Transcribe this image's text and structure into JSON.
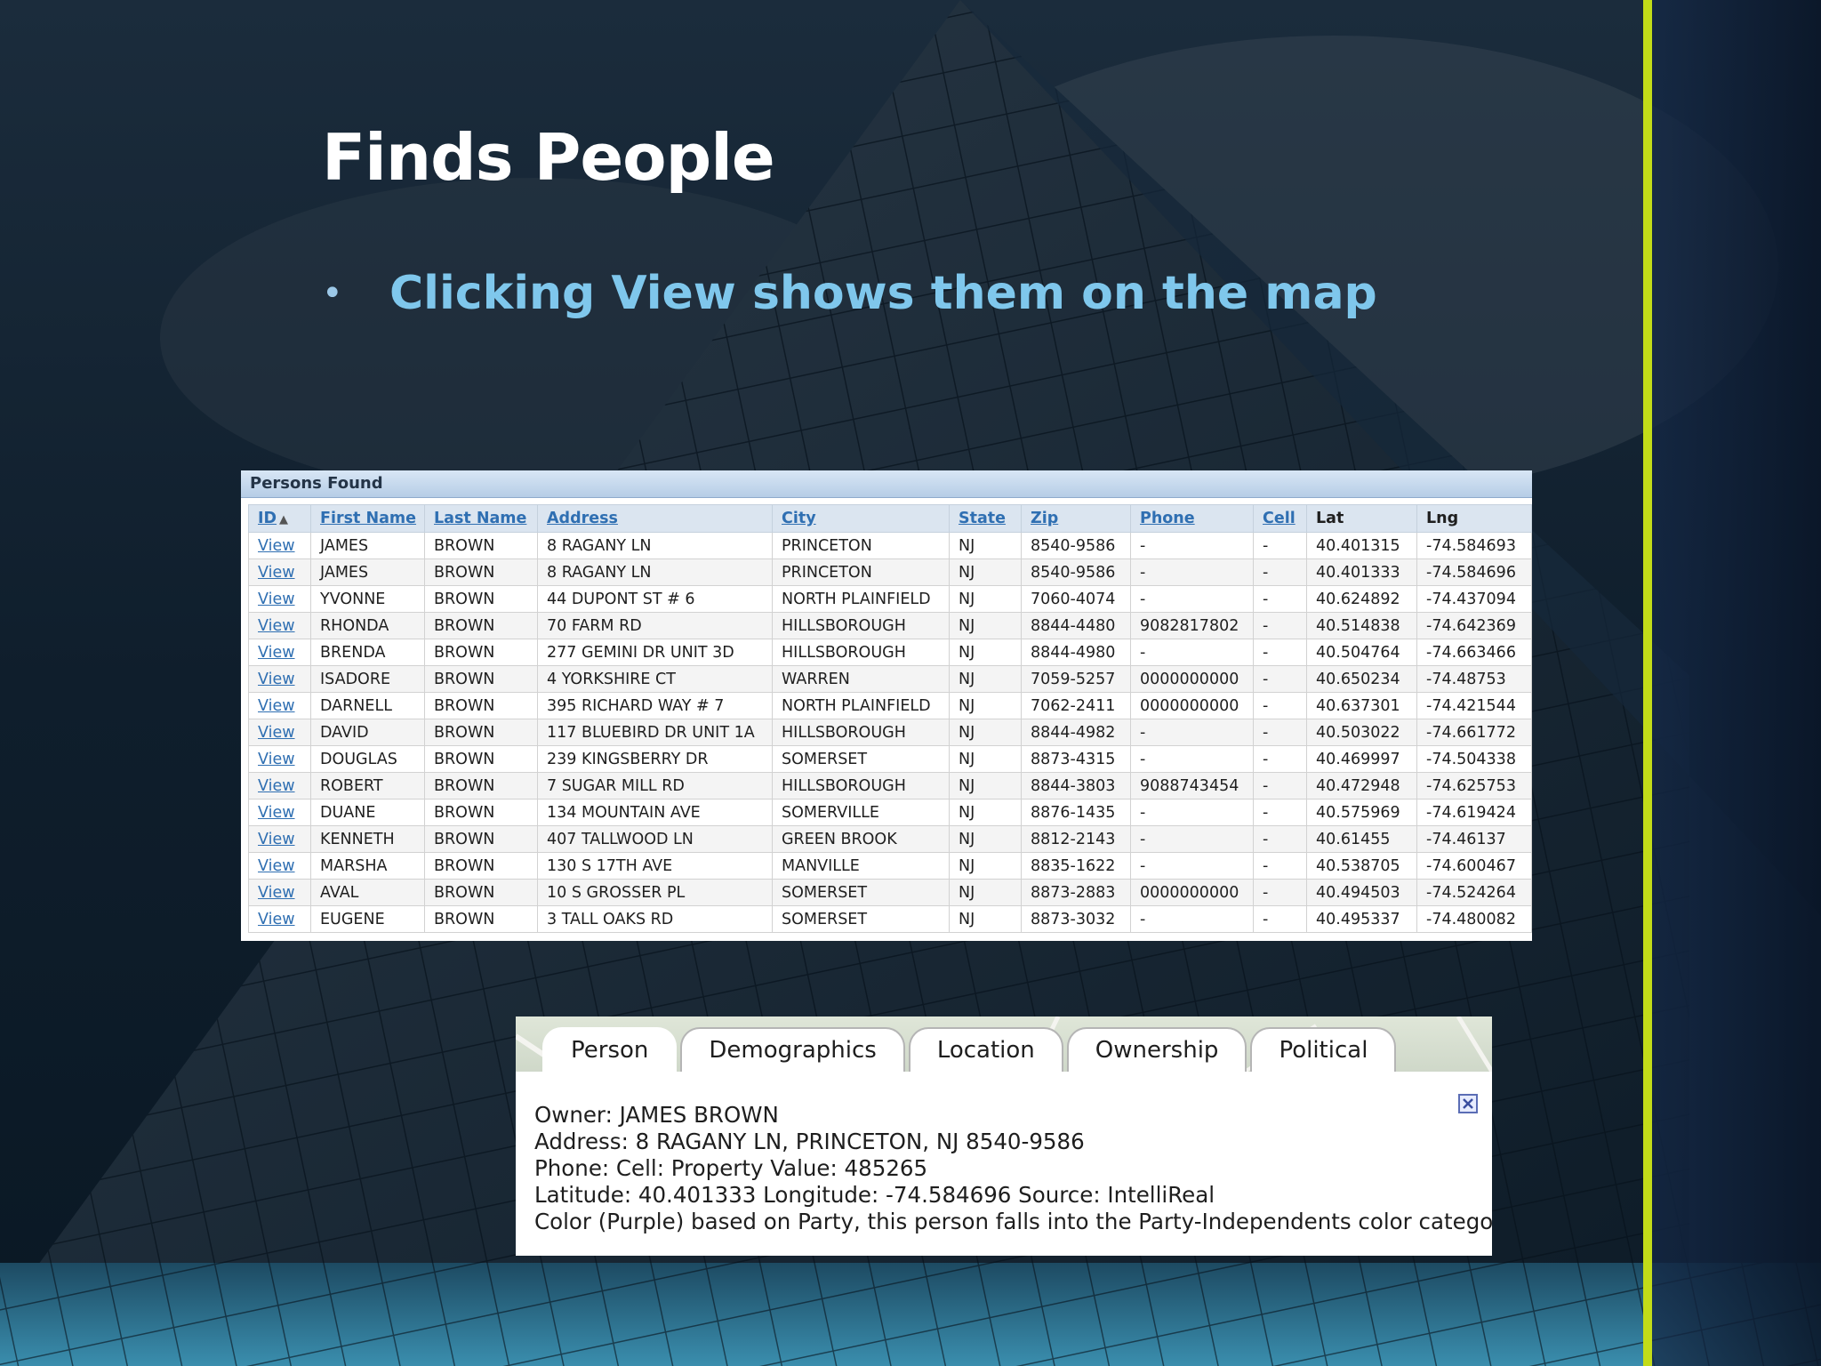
{
  "slide": {
    "title": "Finds People",
    "bullet": "Clicking View shows them on the map"
  },
  "persons_panel": {
    "header": "Persons Found",
    "columns": [
      "ID",
      "First Name",
      "Last Name",
      "Address",
      "City",
      "State",
      "Zip",
      "Phone",
      "Cell",
      "Lat",
      "Lng"
    ],
    "sort_indicator": "▲",
    "rows": [
      [
        "View",
        "JAMES",
        "BROWN",
        "8 RAGANY LN",
        "PRINCETON",
        "NJ",
        "8540-9586",
        "-",
        "-",
        "40.401315",
        "-74.584693"
      ],
      [
        "View",
        "JAMES",
        "BROWN",
        "8 RAGANY LN",
        "PRINCETON",
        "NJ",
        "8540-9586",
        "-",
        "-",
        "40.401333",
        "-74.584696"
      ],
      [
        "View",
        "YVONNE",
        "BROWN",
        "44 DUPONT ST # 6",
        "NORTH PLAINFIELD",
        "NJ",
        "7060-4074",
        "-",
        "-",
        "40.624892",
        "-74.437094"
      ],
      [
        "View",
        "RHONDA",
        "BROWN",
        "70 FARM RD",
        "HILLSBOROUGH",
        "NJ",
        "8844-4480",
        "9082817802",
        "-",
        "40.514838",
        "-74.642369"
      ],
      [
        "View",
        "BRENDA",
        "BROWN",
        "277 GEMINI DR UNIT 3D",
        "HILLSBOROUGH",
        "NJ",
        "8844-4980",
        "-",
        "-",
        "40.504764",
        "-74.663466"
      ],
      [
        "View",
        "ISADORE",
        "BROWN",
        "4 YORKSHIRE CT",
        "WARREN",
        "NJ",
        "7059-5257",
        "0000000000",
        "-",
        "40.650234",
        "-74.48753"
      ],
      [
        "View",
        "DARNELL",
        "BROWN",
        "395 RICHARD WAY # 7",
        "NORTH PLAINFIELD",
        "NJ",
        "7062-2411",
        "0000000000",
        "-",
        "40.637301",
        "-74.421544"
      ],
      [
        "View",
        "DAVID",
        "BROWN",
        "117 BLUEBIRD DR UNIT 1A",
        "HILLSBOROUGH",
        "NJ",
        "8844-4982",
        "-",
        "-",
        "40.503022",
        "-74.661772"
      ],
      [
        "View",
        "DOUGLAS",
        "BROWN",
        "239 KINGSBERRY DR",
        "SOMERSET",
        "NJ",
        "8873-4315",
        "-",
        "-",
        "40.469997",
        "-74.504338"
      ],
      [
        "View",
        "ROBERT",
        "BROWN",
        "7 SUGAR MILL RD",
        "HILLSBOROUGH",
        "NJ",
        "8844-3803",
        "9088743454",
        "-",
        "40.472948",
        "-74.625753"
      ],
      [
        "View",
        "DUANE",
        "BROWN",
        "134 MOUNTAIN AVE",
        "SOMERVILLE",
        "NJ",
        "8876-1435",
        "-",
        "-",
        "40.575969",
        "-74.619424"
      ],
      [
        "View",
        "KENNETH",
        "BROWN",
        "407 TALLWOOD LN",
        "GREEN BROOK",
        "NJ",
        "8812-2143",
        "-",
        "-",
        "40.61455",
        "-74.46137"
      ],
      [
        "View",
        "MARSHA",
        "BROWN",
        "130 S 17TH AVE",
        "MANVILLE",
        "NJ",
        "8835-1622",
        "-",
        "-",
        "40.538705",
        "-74.600467"
      ],
      [
        "View",
        "AVAL",
        "BROWN",
        "10 S GROSSER PL",
        "SOMERSET",
        "NJ",
        "8873-2883",
        "0000000000",
        "-",
        "40.494503",
        "-74.524264"
      ],
      [
        "View",
        "EUGENE",
        "BROWN",
        "3 TALL OAKS RD",
        "SOMERSET",
        "NJ",
        "8873-3032",
        "-",
        "-",
        "40.495337",
        "-74.480082"
      ]
    ]
  },
  "map_popup": {
    "tabs": [
      "Person",
      "Demographics",
      "Location",
      "Ownership",
      "Political"
    ],
    "active_tab": "Person",
    "info_lines": [
      "Owner: JAMES BROWN",
      "Address: 8 RAGANY LN, PRINCETON, NJ 8540-9586",
      "Phone: Cell: Property Value: 485265",
      "Latitude: 40.401333 Longitude: -74.584696 Source: IntelliReal",
      "Color (Purple) based on Party, this person falls into the Party-Independents color category"
    ]
  },
  "colors": {
    "accent_line": "#c2dc18",
    "bullet_text": "#7fc7ec",
    "link": "#2f6fb2"
  }
}
